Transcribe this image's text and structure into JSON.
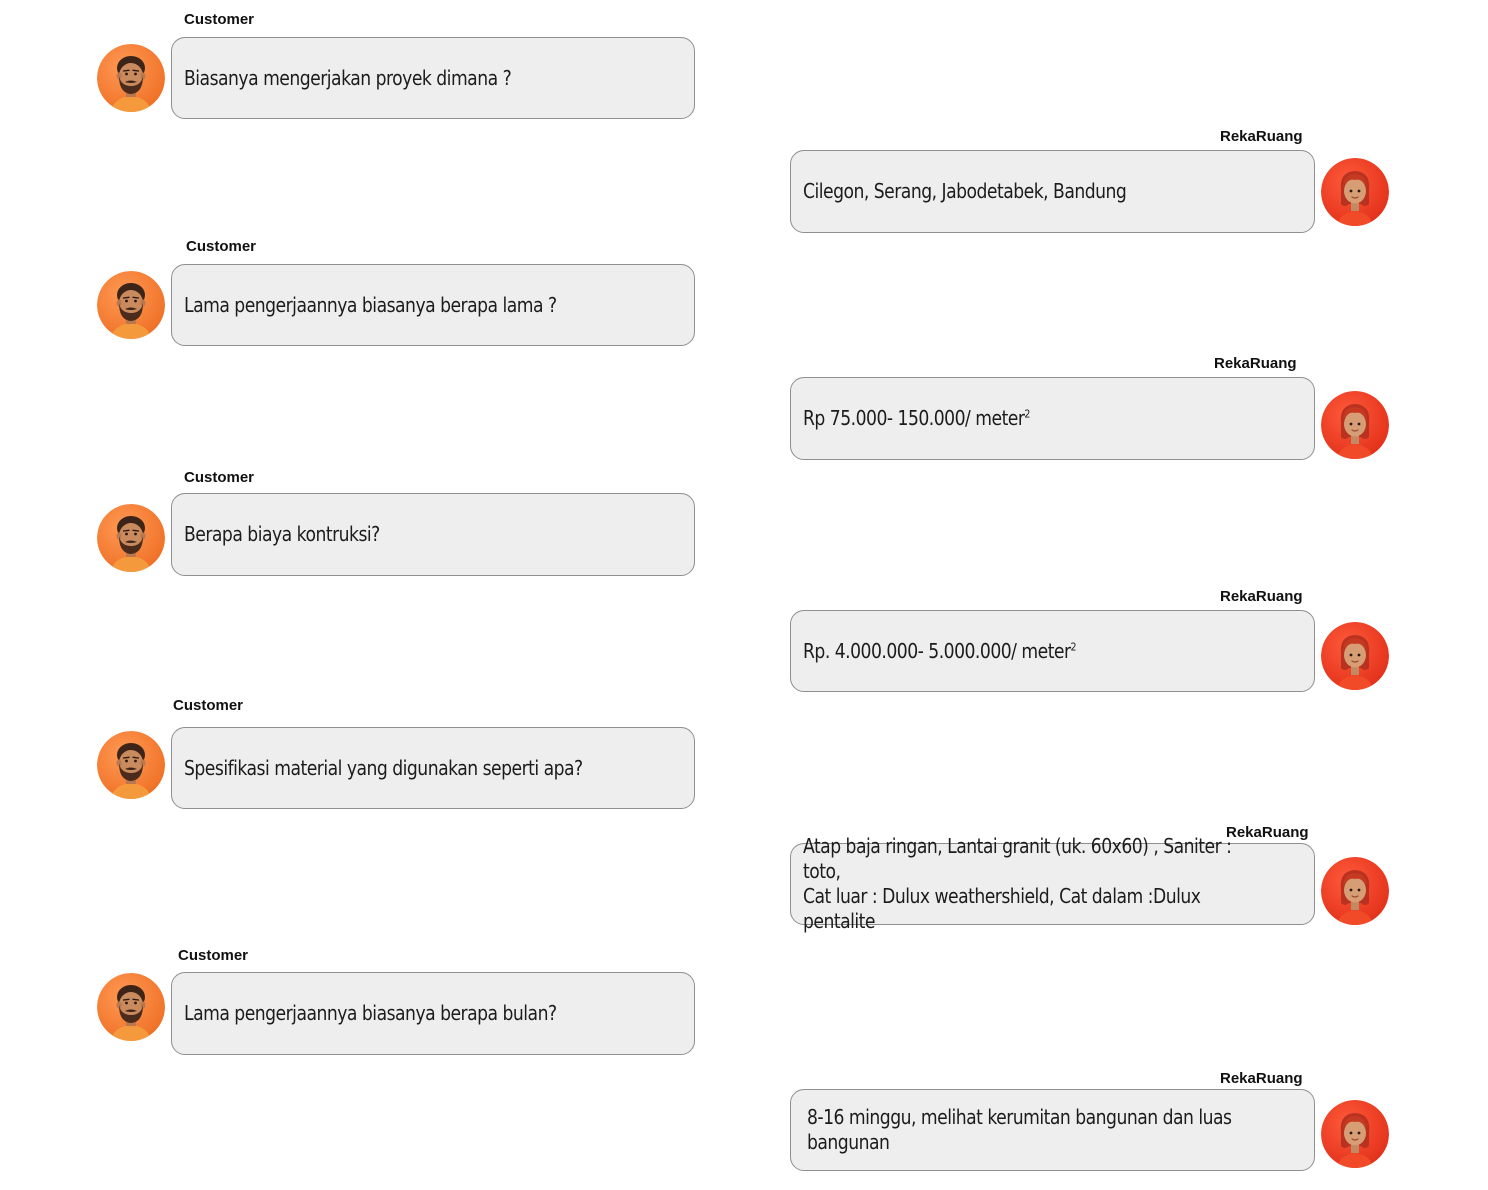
{
  "conversation": {
    "customer_label": "Customer",
    "agent_label": "RekaRuang",
    "messages": [
      {
        "from": "Customer",
        "text": "Biasanya mengerjakan proyek dimana ?"
      },
      {
        "from": "RekaRuang",
        "text": "Cilegon, Serang, Jabodetabek, Bandung"
      },
      {
        "from": "Customer",
        "text": "Lama pengerjaannya biasanya berapa lama ?"
      },
      {
        "from": "RekaRuang",
        "text": "Rp 75.000- 150.000/ meter",
        "sup": "2"
      },
      {
        "from": "Customer",
        "text": "Berapa biaya kontruksi?"
      },
      {
        "from": "RekaRuang",
        "text": "Rp. 4.000.000- 5.000.000/ meter",
        "sup": "2"
      },
      {
        "from": "Customer",
        "text": "Spesifikasi material yang digunakan seperti apa?"
      },
      {
        "from": "RekaRuang",
        "text": "Atap baja ringan, Lantai granit (uk. 60x60) , Saniter : toto,\nCat luar : Dulux weathershield, Cat dalam :Dulux pentalite"
      },
      {
        "from": "Customer",
        "text": "Lama pengerjaannya biasanya berapa bulan?"
      },
      {
        "from": "RekaRuang",
        "text": "8-16 minggu, melihat kerumitan bangunan dan luas bangunan"
      }
    ]
  },
  "colors": {
    "bubble_bg": "#eeeeee",
    "bubble_border": "#8f8f8f",
    "avatar_customer": "#f27b33",
    "avatar_agent": "#ea3a1f"
  },
  "icons": {
    "customer_avatar": "bearded-man-avatar-icon",
    "agent_avatar": "woman-avatar-icon"
  }
}
